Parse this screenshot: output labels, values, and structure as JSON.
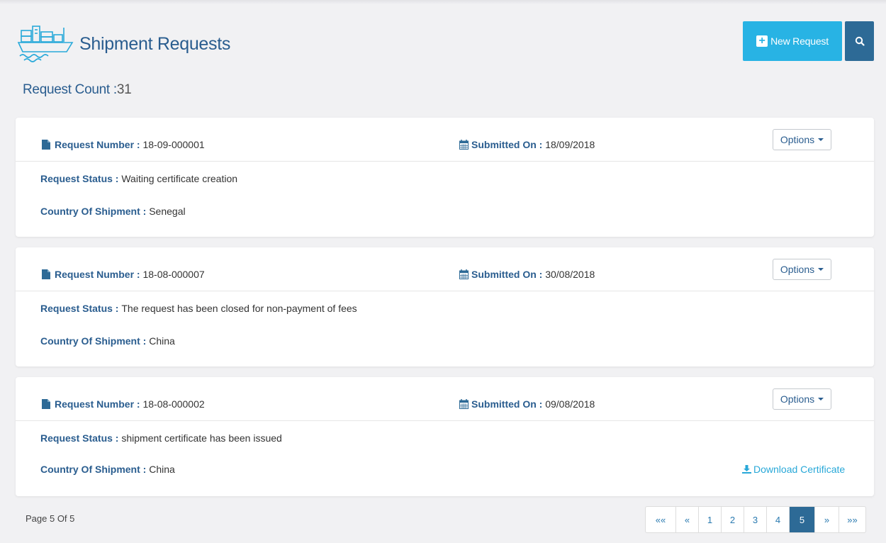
{
  "header": {
    "title": "Shipment Requests",
    "new_request_label": "New Request"
  },
  "summary": {
    "count_label": "Request Count :",
    "count_value": "31"
  },
  "labels": {
    "request_number": "Request Number :",
    "submitted_on": "Submitted On :",
    "request_status": "Request Status :",
    "country": "Country Of Shipment :",
    "options": "Options",
    "download": "Download Certificate"
  },
  "requests": [
    {
      "number": "18-09-000001",
      "submitted": "18/09/2018",
      "status": "Waiting certificate creation",
      "country": "Senegal"
    },
    {
      "number": "18-08-000007",
      "submitted": "30/08/2018",
      "status": "The request has been closed for non-payment of fees",
      "country": "China"
    },
    {
      "number": "18-08-000002",
      "submitted": "09/08/2018",
      "status": "shipment certificate has been issued",
      "country": "China"
    }
  ],
  "pagination": {
    "page_text": "Page 5 Of 5",
    "first": "««",
    "prev": "«",
    "pages": [
      "1",
      "2",
      "3",
      "4",
      "5"
    ],
    "next": "»",
    "last": "»»",
    "current": "5"
  },
  "colors": {
    "accent": "#28b3e4",
    "primary": "#2d6a96",
    "label": "#2a5d8f"
  }
}
